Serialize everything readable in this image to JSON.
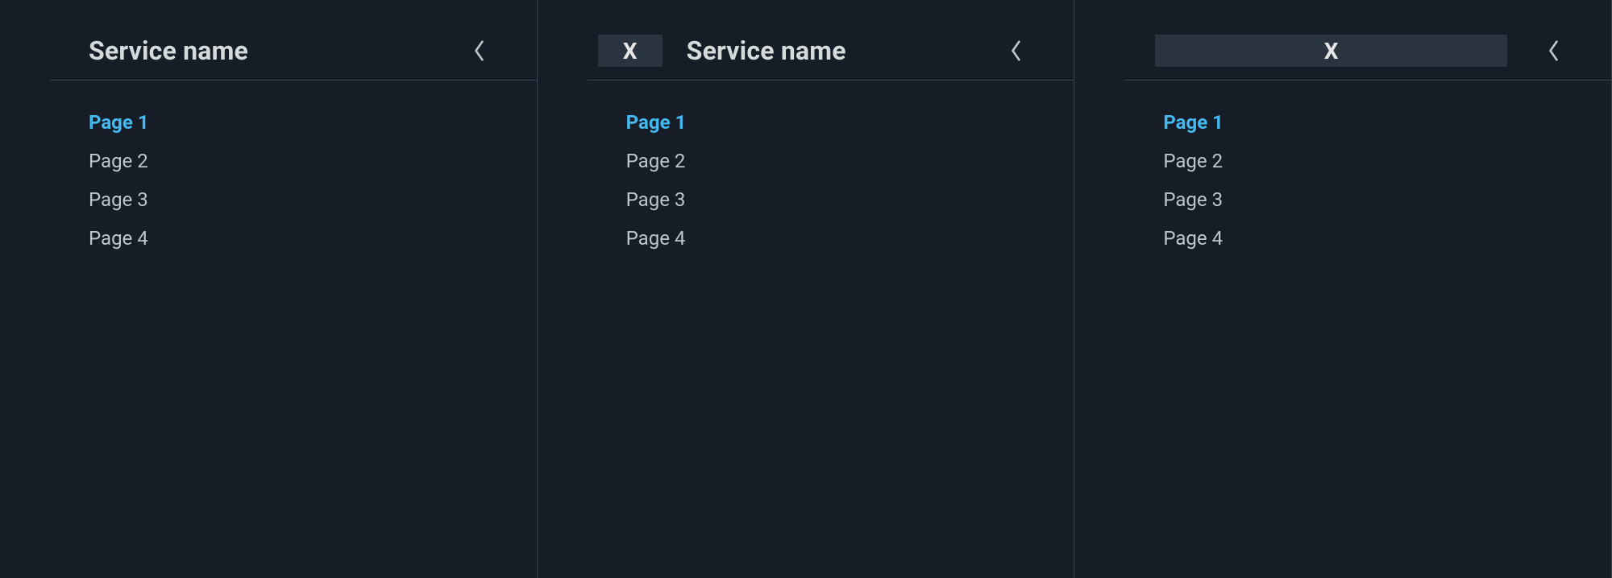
{
  "panels": [
    {
      "variant": "a",
      "title": "Service name",
      "logo_label": "",
      "nav": [
        "Page 1",
        "Page 2",
        "Page 3",
        "Page 4"
      ],
      "active_index": 0
    },
    {
      "variant": "b",
      "title": "Service name",
      "logo_label": "X",
      "nav": [
        "Page 1",
        "Page 2",
        "Page 3",
        "Page 4"
      ],
      "active_index": 0
    },
    {
      "variant": "c",
      "title": "",
      "logo_label": "X",
      "nav": [
        "Page 1",
        "Page 2",
        "Page 3",
        "Page 4"
      ],
      "active_index": 0
    }
  ]
}
